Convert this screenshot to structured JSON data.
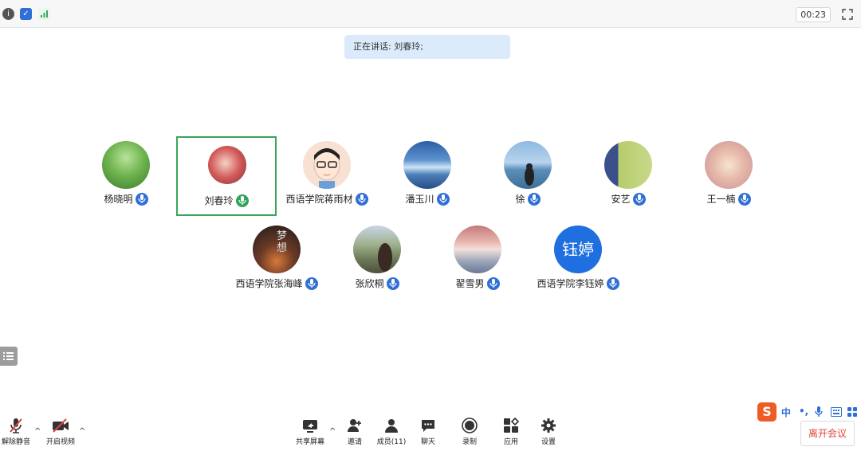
{
  "header": {
    "timer": "00:23"
  },
  "speaking": {
    "text": "正在讲话: 刘春玲;"
  },
  "participants": [
    {
      "name": "杨晓明"
    },
    {
      "name": "刘春玲"
    },
    {
      "name": "西语学院蒋雨材"
    },
    {
      "name": "潘玉川"
    },
    {
      "name": "徐"
    },
    {
      "name": "安艺"
    },
    {
      "name": "王一楠"
    },
    {
      "name": "西语学院张海峰"
    },
    {
      "name": "张欣桐"
    },
    {
      "name": "翟雪男"
    },
    {
      "name": "西语学院李钰婷",
      "initials": "钰婷"
    }
  ],
  "avatar_texts": {
    "dream": "梦想"
  },
  "toolbar": {
    "unmute": "解除静音",
    "start_video": "开启视频",
    "share_screen": "共享屏幕",
    "invite": "邀请",
    "members": "成员(11)",
    "chat": "聊天",
    "record": "录制",
    "apps": "应用",
    "settings": "设置",
    "leave": "离开会议"
  },
  "ime": {
    "logo": "S",
    "mode": "中",
    "punct": "•,"
  },
  "colors": {
    "accent_blue": "#2f6fd6",
    "active_green": "#3aa55a",
    "leave_red": "#e0443a"
  }
}
